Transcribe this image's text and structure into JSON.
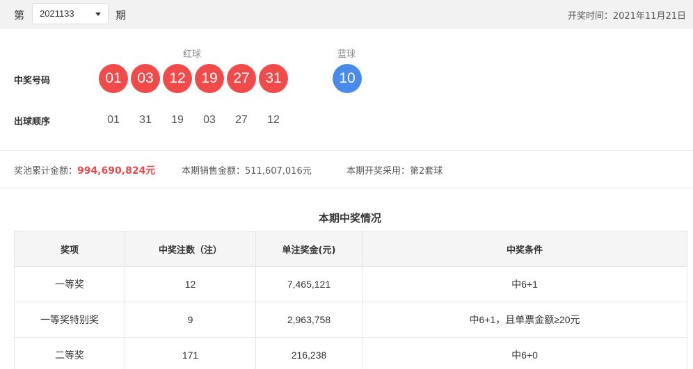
{
  "header": {
    "label_di": "第",
    "issue_value": "2021133",
    "label_qi": "期",
    "draw_time": "开奖时间：2021年11月21日"
  },
  "result": {
    "red_heading": "红球",
    "blue_heading": "蓝球",
    "winning_label": "中奖号码",
    "order_label": "出球顺序",
    "red_balls": [
      "01",
      "03",
      "12",
      "19",
      "27",
      "31"
    ],
    "blue_ball": "10",
    "draw_order": [
      "01",
      "31",
      "19",
      "03",
      "27",
      "12"
    ]
  },
  "info": {
    "pool_label": "奖池累计金额：",
    "pool_value": "994,690,824元",
    "sales_label": "本期销售金额：",
    "sales_value": "511,607,016元",
    "set_label": "本期开奖采用：",
    "set_value": "第2套球"
  },
  "prize_table": {
    "title": "本期中奖情况",
    "headers": [
      "奖项",
      "中奖注数（注）",
      "单注奖金(元)",
      "中奖条件"
    ],
    "rows": [
      [
        "一等奖",
        "12",
        "7,465,121",
        "中6+1"
      ],
      [
        "一等奖特别奖",
        "9",
        "2,963,758",
        "中6+1，且单票金额≥20元"
      ],
      [
        "二等奖",
        "171",
        "216,238",
        "中6+0"
      ]
    ]
  },
  "colors": {
    "red_ball": "#f04a4a",
    "blue_ball": "#4a8bea",
    "highlight": "#e84a4a"
  }
}
